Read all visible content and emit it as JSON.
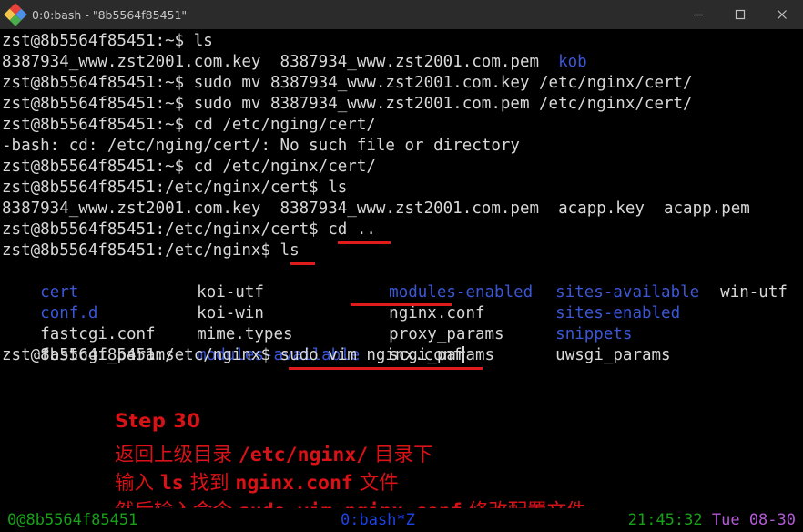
{
  "window": {
    "title": "0:0:bash - \"8b5564f85451\"",
    "icon": "app-diamond-icon",
    "controls": {
      "minimize": "minimize-icon",
      "maximize": "maximize-icon",
      "close": "close-icon"
    }
  },
  "terminal": {
    "prompt_home": "zst@8b5564f85451:~$",
    "prompt_cert": "zst@8b5564f85451:/etc/nginx/cert$",
    "prompt_nginx": "zst@8b5564f85451:/etc/nginx$",
    "lines": {
      "l1_cmd": "zst@8b5564f85451:~$ ls",
      "l2_out_a": "8387934_www.zst2001.com.key  8387934_www.zst2001.com.pem  ",
      "l2_out_dir": "kob",
      "l3_cmd": "zst@8b5564f85451:~$ sudo mv 8387934_www.zst2001.com.key /etc/nginx/cert/",
      "l4_cmd": "zst@8b5564f85451:~$ sudo mv 8387934_www.zst2001.com.pem /etc/nginx/cert/",
      "l5_cmd": "zst@8b5564f85451:~$ cd /etc/nging/cert/",
      "l6_err": "-bash: cd: /etc/nging/cert/: No such file or directory",
      "l7_cmd": "zst@8b5564f85451:~$ cd /etc/nginx/cert/",
      "l8_cmd": "zst@8b5564f85451:/etc/nginx/cert$ ls",
      "l9_out": "8387934_www.zst2001.com.key  8387934_www.zst2001.com.pem  acapp.key  acapp.pem",
      "l10_cmd": "zst@8b5564f85451:/etc/nginx/cert$ cd ..",
      "l11_cmd": "zst@8b5564f85451:/etc/nginx$ ls",
      "l17_cmd": "zst@8b5564f85451:/etc/nginx$ sudo vim nginx.conf"
    },
    "ls_grid": {
      "col1": [
        {
          "name": "cert",
          "type": "dir"
        },
        {
          "name": "conf.d",
          "type": "dir"
        },
        {
          "name": "fastcgi.conf",
          "type": "file"
        },
        {
          "name": "fastcgi_params",
          "type": "file"
        }
      ],
      "col2": [
        {
          "name": "koi-utf",
          "type": "file"
        },
        {
          "name": "koi-win",
          "type": "file"
        },
        {
          "name": "mime.types",
          "type": "file"
        },
        {
          "name": "modules-available",
          "type": "dir"
        }
      ],
      "col3": [
        {
          "name": "modules-enabled",
          "type": "dir"
        },
        {
          "name": "nginx.conf",
          "type": "file"
        },
        {
          "name": "proxy_params",
          "type": "file"
        },
        {
          "name": "scgi_params",
          "type": "file"
        }
      ],
      "col4": [
        {
          "name": "sites-available",
          "type": "dir"
        },
        {
          "name": "sites-enabled",
          "type": "dir"
        },
        {
          "name": "snippets",
          "type": "dir"
        },
        {
          "name": "uwsgi_params",
          "type": "file"
        }
      ],
      "col5": [
        {
          "name": "win-utf",
          "type": "file"
        }
      ]
    }
  },
  "annotation": {
    "step": "Step 30",
    "line1_a": "返回上级目录 ",
    "line1_b": "/etc/nginx/",
    "line1_c": " 目录下",
    "line2_a": "输入 ",
    "line2_b": "ls",
    "line2_c": " 找到 ",
    "line2_d": "nginx.conf",
    "line2_e": " 文件",
    "line3_a": "然后输入命令 ",
    "line3_b": "sudo vim nginx.conf",
    "line3_c": " 修改配置文件",
    "color": "#d81217"
  },
  "statusbar": {
    "left": "0@8b5564f85451",
    "center": "0:bash*Z",
    "time": "21:45:32",
    "date": "Tue 08-30",
    "color_left": "#18a018",
    "color_center": "#1c42e8",
    "color_time": "#18a018",
    "color_date": "#b45ad6"
  }
}
